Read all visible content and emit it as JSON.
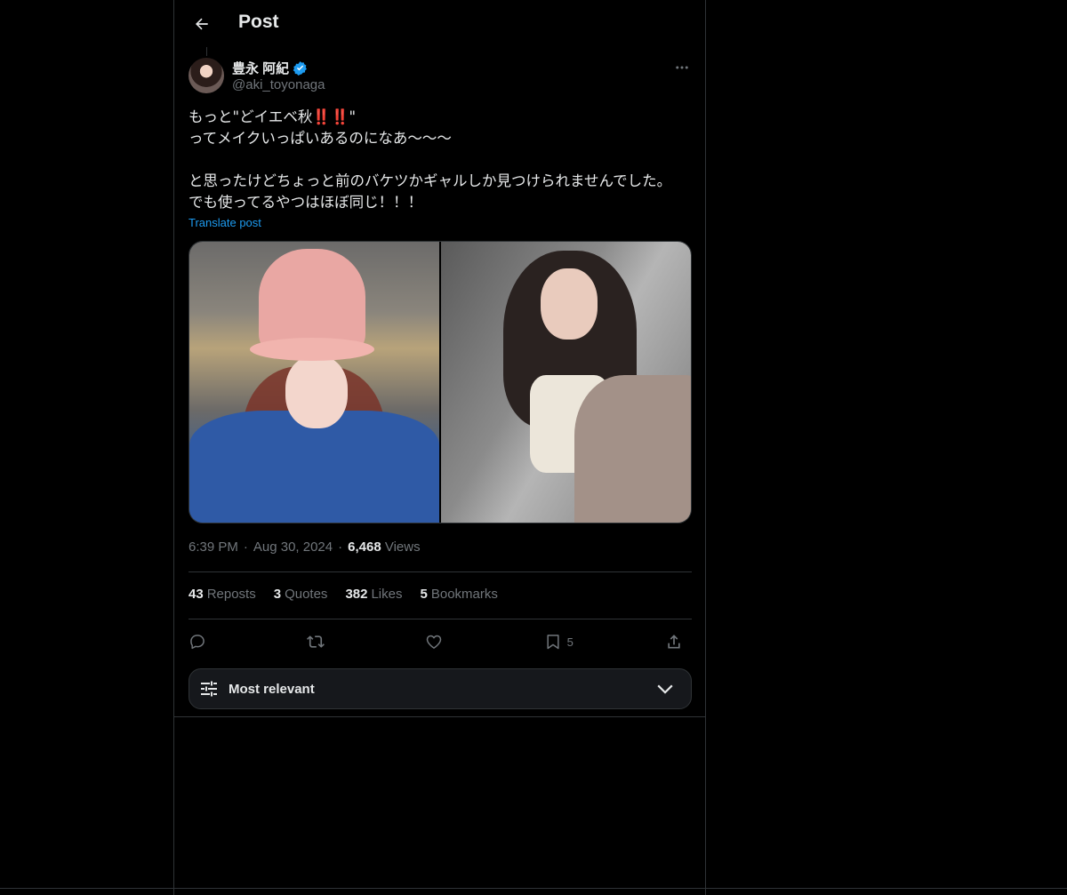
{
  "header": {
    "title": "Post"
  },
  "author": {
    "name": "豊永 阿紀",
    "handle": "@aki_toyonaga"
  },
  "post": {
    "text": "もっと\"どイエベ秋‼️‼️\"\nってメイクいっぱいあるのになあ〜〜〜\n\nと思ったけどちょっと前のバケツかギャルしか見つけられませんでした。\nでも使ってるやつはほぼ同じ！！！",
    "translate_label": "Translate post",
    "time": "6:39 PM",
    "date": "Aug 30, 2024",
    "views_count": "6,468",
    "views_label": "Views"
  },
  "stats": {
    "reposts_count": "43",
    "reposts_label": "Reposts",
    "quotes_count": "3",
    "quotes_label": "Quotes",
    "likes_count": "382",
    "likes_label": "Likes",
    "bookmarks_count": "5",
    "bookmarks_label": "Bookmarks"
  },
  "actions": {
    "bookmark_count": "5"
  },
  "sort": {
    "label": "Most relevant"
  },
  "colors": {
    "accent": "#1d9bf0",
    "background": "#000000",
    "text": "#e7e9ea",
    "muted": "#71767b",
    "border": "#2f3336"
  }
}
